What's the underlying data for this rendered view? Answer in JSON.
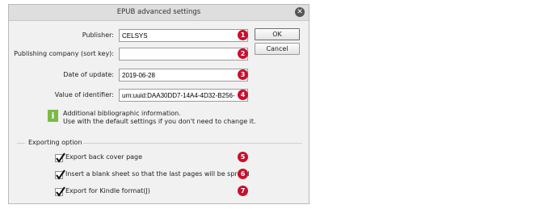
{
  "dialog": {
    "title": "EPUB advanced settings",
    "close_icon": "close-icon"
  },
  "fields": {
    "publisher": {
      "label": "Publisher:",
      "value": "CELSYS",
      "badge": "1"
    },
    "publishing_company": {
      "label": "Publishing company (sort key):",
      "value": "",
      "badge": "2"
    },
    "date_of_update": {
      "label": "Date of update:",
      "value": "2019-06-28",
      "badge": "3"
    },
    "identifier": {
      "label": "Value of identifier:",
      "value": "urn:uuid:DAA30DD7-14A4-4D32-B256-",
      "badge": "4"
    }
  },
  "buttons": {
    "ok": "OK",
    "cancel": "Cancel"
  },
  "info": {
    "icon": "info-icon",
    "line1": "Additional bibliographic information.",
    "line2": "Use with the default settings if you don't need to change it."
  },
  "export": {
    "group_title": "Exporting option",
    "options": [
      {
        "label": "Export back cover page",
        "checked": true,
        "badge": "5"
      },
      {
        "label": "Insert a blank sheet so that the last pages will be spread",
        "checked": true,
        "badge": "6"
      },
      {
        "label": "Export for Kindle format(J)",
        "checked": true,
        "badge": "7"
      }
    ]
  },
  "colors": {
    "badge": "#c8102e",
    "info_icon": "#7cb947"
  }
}
